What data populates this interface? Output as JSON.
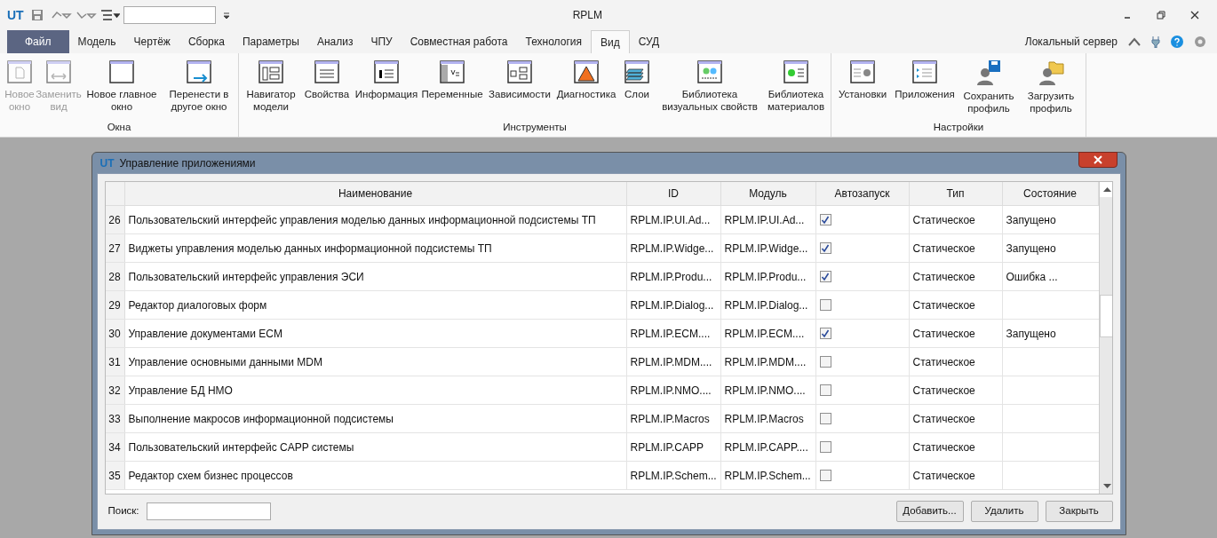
{
  "app": {
    "logo": "UT",
    "title": "RPLM",
    "server": "Локальный сервер"
  },
  "tabs": [
    {
      "label": "Файл",
      "kind": "file",
      "selected": false
    },
    {
      "label": "Модель",
      "kind": "tab",
      "selected": false
    },
    {
      "label": "Чертёж",
      "kind": "tab",
      "selected": false
    },
    {
      "label": "Сборка",
      "kind": "tab",
      "selected": false
    },
    {
      "label": "Параметры",
      "kind": "tab",
      "selected": false
    },
    {
      "label": "Анализ",
      "kind": "tab",
      "selected": false
    },
    {
      "label": "ЧПУ",
      "kind": "tab",
      "selected": false
    },
    {
      "label": "Совместная работа",
      "kind": "tab",
      "selected": false
    },
    {
      "label": "Технология",
      "kind": "tab",
      "selected": false
    },
    {
      "label": "Вид",
      "kind": "tab",
      "selected": true
    },
    {
      "label": "СУД",
      "kind": "tab",
      "selected": false
    }
  ],
  "ribbon_groups": [
    {
      "label": "Окна",
      "buttons": [
        {
          "label": "Новое окно",
          "disabled": true
        },
        {
          "label": "Заменить вид",
          "disabled": true
        },
        {
          "label": "Новое главное окно",
          "disabled": false
        },
        {
          "label": "Перенести в другое окно",
          "disabled": false
        }
      ]
    },
    {
      "label": "Инструменты",
      "buttons": [
        {
          "label": "Навигатор модели",
          "disabled": false
        },
        {
          "label": "Свойства",
          "disabled": false
        },
        {
          "label": "Информация",
          "disabled": false
        },
        {
          "label": "Переменные",
          "disabled": false
        },
        {
          "label": "Зависимости",
          "disabled": false
        },
        {
          "label": "Диагностика",
          "disabled": false
        },
        {
          "label": "Слои",
          "disabled": false
        },
        {
          "label": "Библиотека визуальных свойств",
          "disabled": false
        },
        {
          "label": "Библиотека материалов",
          "disabled": false
        }
      ]
    },
    {
      "label": "Настройки",
      "buttons": [
        {
          "label": "Установки",
          "disabled": false
        },
        {
          "label": "Приложения",
          "disabled": false
        },
        {
          "label": "Сохранить профиль",
          "disabled": false
        },
        {
          "label": "Загрузить профиль",
          "disabled": false
        }
      ]
    }
  ],
  "dialog": {
    "logo": "UT",
    "title": "Управление приложениями",
    "table": {
      "columns": [
        "Наименование",
        "ID",
        "Модуль",
        "Автозапуск",
        "Тип",
        "Состояние"
      ],
      "rows": [
        {
          "number": "26",
          "name": "Пользовательский интерфейс управления моделью данных информационной подсистемы ТП",
          "id": "RPLM.IP.UI.Ad...",
          "module": "RPLM.IP.UI.Ad...",
          "autostart": true,
          "type": "Статическое",
          "state": "Запущено"
        },
        {
          "number": "27",
          "name": "Виджеты управления моделью данных информационной подсистемы ТП",
          "id": "RPLM.IP.Widge...",
          "module": "RPLM.IP.Widge...",
          "autostart": true,
          "type": "Статическое",
          "state": "Запущено"
        },
        {
          "number": "28",
          "name": "Пользовательский интерфейс управления ЭСИ",
          "id": "RPLM.IP.Produ...",
          "module": "RPLM.IP.Produ...",
          "autostart": true,
          "type": "Статическое",
          "state": "Ошибка ..."
        },
        {
          "number": "29",
          "name": "Редактор диалоговых форм",
          "id": "RPLM.IP.Dialog...",
          "module": "RPLM.IP.Dialog...",
          "autostart": false,
          "type": "Статическое"
        },
        {
          "number": "30",
          "name": "Управление документами ECM",
          "id": "RPLM.IP.ECM....",
          "module": "RPLM.IP.ECM....",
          "autostart": true,
          "type": "Статическое",
          "state": "Запущено"
        },
        {
          "number": "31",
          "name": "Управление основными данными MDM",
          "id": "RPLM.IP.MDM....",
          "module": "RPLM.IP.MDM....",
          "autostart": false,
          "type": "Статическое"
        },
        {
          "number": "32",
          "name": "Управление БД НМО",
          "id": "RPLM.IP.NMO....",
          "module": "RPLM.IP.NMO....",
          "autostart": false,
          "type": "Статическое"
        },
        {
          "number": "33",
          "name": "Выполнение макросов информационной подсистемы",
          "id": "RPLM.IP.Macros",
          "module": "RPLM.IP.Macros",
          "autostart": false,
          "type": "Статическое"
        },
        {
          "number": "34",
          "name": "Пользовательский интерфейс CAPP системы",
          "id": "RPLM.IP.CAPP",
          "module": "RPLM.IP.CAPP....",
          "autostart": false,
          "type": "Статическое"
        },
        {
          "number": "35",
          "name": "Редактор схем бизнес процессов",
          "id": "RPLM.IP.Schem...",
          "module": "RPLM.IP.Schem...",
          "autostart": false,
          "type": "Статическое"
        }
      ]
    },
    "search": {
      "label": "Поиск:"
    },
    "buttons": [
      "Добавить...",
      "Удалить",
      "Закрыть"
    ]
  }
}
